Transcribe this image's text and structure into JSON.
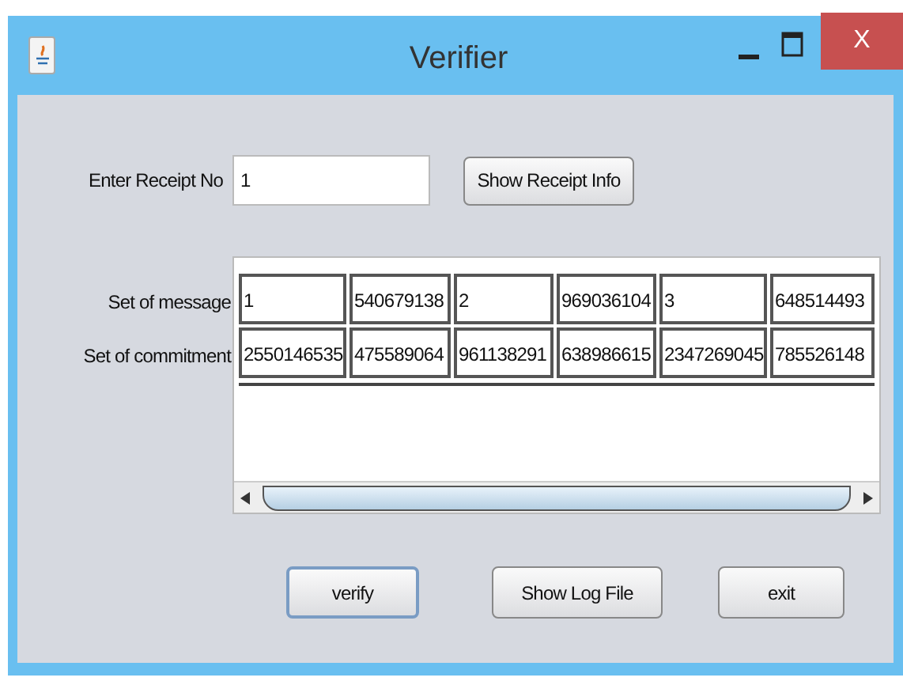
{
  "window": {
    "title": "Verifier",
    "close_label": "X"
  },
  "receipt": {
    "label": "Enter Receipt No",
    "value": "1",
    "button": "Show Receipt Info"
  },
  "table": {
    "rows": [
      {
        "label": "Set of message",
        "cells": [
          "1",
          "540679138",
          "2",
          "969036104",
          "3",
          "648514493"
        ]
      },
      {
        "label": "Set of commitment",
        "cells": [
          "2550146535",
          "475589064",
          "961138291",
          "638986615",
          "2347269045",
          "785526148"
        ]
      }
    ]
  },
  "buttons": [
    {
      "label": "verify",
      "focused": true
    },
    {
      "label": "Show Log File",
      "focused": false
    },
    {
      "label": "exit",
      "focused": false
    }
  ]
}
